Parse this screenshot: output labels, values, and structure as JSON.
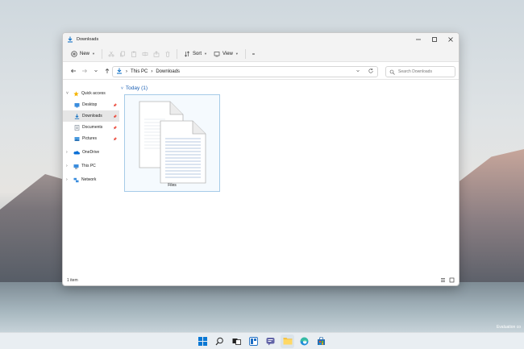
{
  "window": {
    "title": "Downloads"
  },
  "commandbar": {
    "new_label": "New",
    "sort_label": "Sort",
    "view_label": "View",
    "more_label": "•••"
  },
  "address": {
    "crumbs": [
      "This PC",
      "Downloads"
    ],
    "separator": "›"
  },
  "search": {
    "placeholder": "Search Downloads"
  },
  "sidebar": {
    "quick_access": "Quick access",
    "items": [
      {
        "label": "Desktop",
        "icon": "desktop-icon",
        "pinned": true
      },
      {
        "label": "Downloads",
        "icon": "downloads-icon",
        "pinned": true,
        "active": true
      },
      {
        "label": "Documents",
        "icon": "documents-icon",
        "pinned": true
      },
      {
        "label": "Pictures",
        "icon": "pictures-icon",
        "pinned": true
      }
    ],
    "onedrive": "OneDrive",
    "this_pc": "This PC",
    "network": "Network"
  },
  "content": {
    "group_label": "Today (1)",
    "file_name": "Files"
  },
  "status": {
    "item_count": "1 item"
  },
  "desktop": {
    "evaluation_text": "Evaluation co"
  },
  "colors": {
    "accent": "#0067c0",
    "folder": "#f5c242",
    "tile_border": "#a6cbe8"
  }
}
